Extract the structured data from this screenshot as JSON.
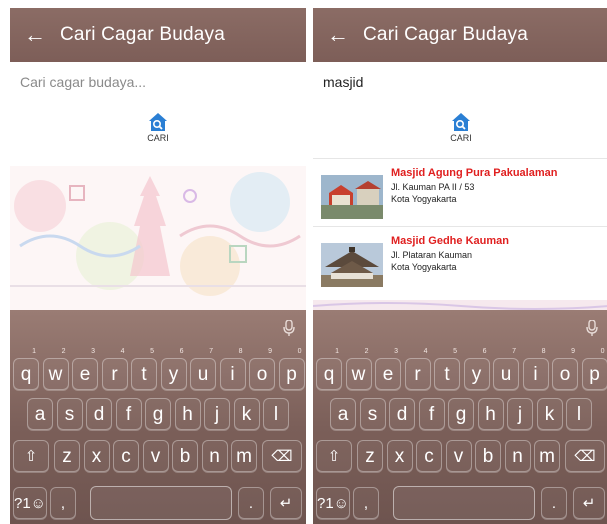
{
  "screens": [
    {
      "title": "Cari Cagar Budaya",
      "search": {
        "value": "",
        "placeholder": "Cari cagar budaya..."
      },
      "search_button_label": "CARI",
      "results": []
    },
    {
      "title": "Cari Cagar Budaya",
      "search": {
        "value": "masjid",
        "placeholder": "Cari cagar budaya..."
      },
      "search_button_label": "CARI",
      "results": [
        {
          "name": "Masjid Agung Pura Pakualaman",
          "address": "Jl. Kauman PA II / 53",
          "city": "Kota Yogyakarta"
        },
        {
          "name": "Masjid Gedhe Kauman",
          "address": "Jl. Plataran Kauman",
          "city": "Kota Yogyakarta"
        }
      ]
    }
  ],
  "keyboard": {
    "row1": [
      {
        "key": "q",
        "hint": "1"
      },
      {
        "key": "w",
        "hint": "2"
      },
      {
        "key": "e",
        "hint": "3"
      },
      {
        "key": "r",
        "hint": "4"
      },
      {
        "key": "t",
        "hint": "5"
      },
      {
        "key": "y",
        "hint": "6"
      },
      {
        "key": "u",
        "hint": "7"
      },
      {
        "key": "i",
        "hint": "8"
      },
      {
        "key": "o",
        "hint": "9"
      },
      {
        "key": "p",
        "hint": "0"
      }
    ],
    "row2": [
      "a",
      "s",
      "d",
      "f",
      "g",
      "h",
      "j",
      "k",
      "l"
    ],
    "row3": [
      "z",
      "x",
      "c",
      "v",
      "b",
      "n",
      "m"
    ],
    "shift_glyph": "⇧",
    "backspace_glyph": "⌫",
    "symbols_label": "?1☺",
    "comma": ",",
    "period": ".",
    "enter_glyph": "↵"
  },
  "icons": {
    "back": "back-arrow-icon",
    "home_search": "home-search-icon",
    "mic": "mic-icon"
  },
  "colors": {
    "appbar": "#8b6c65",
    "result_title": "#e02020",
    "keyboard": "#7b5f59"
  }
}
